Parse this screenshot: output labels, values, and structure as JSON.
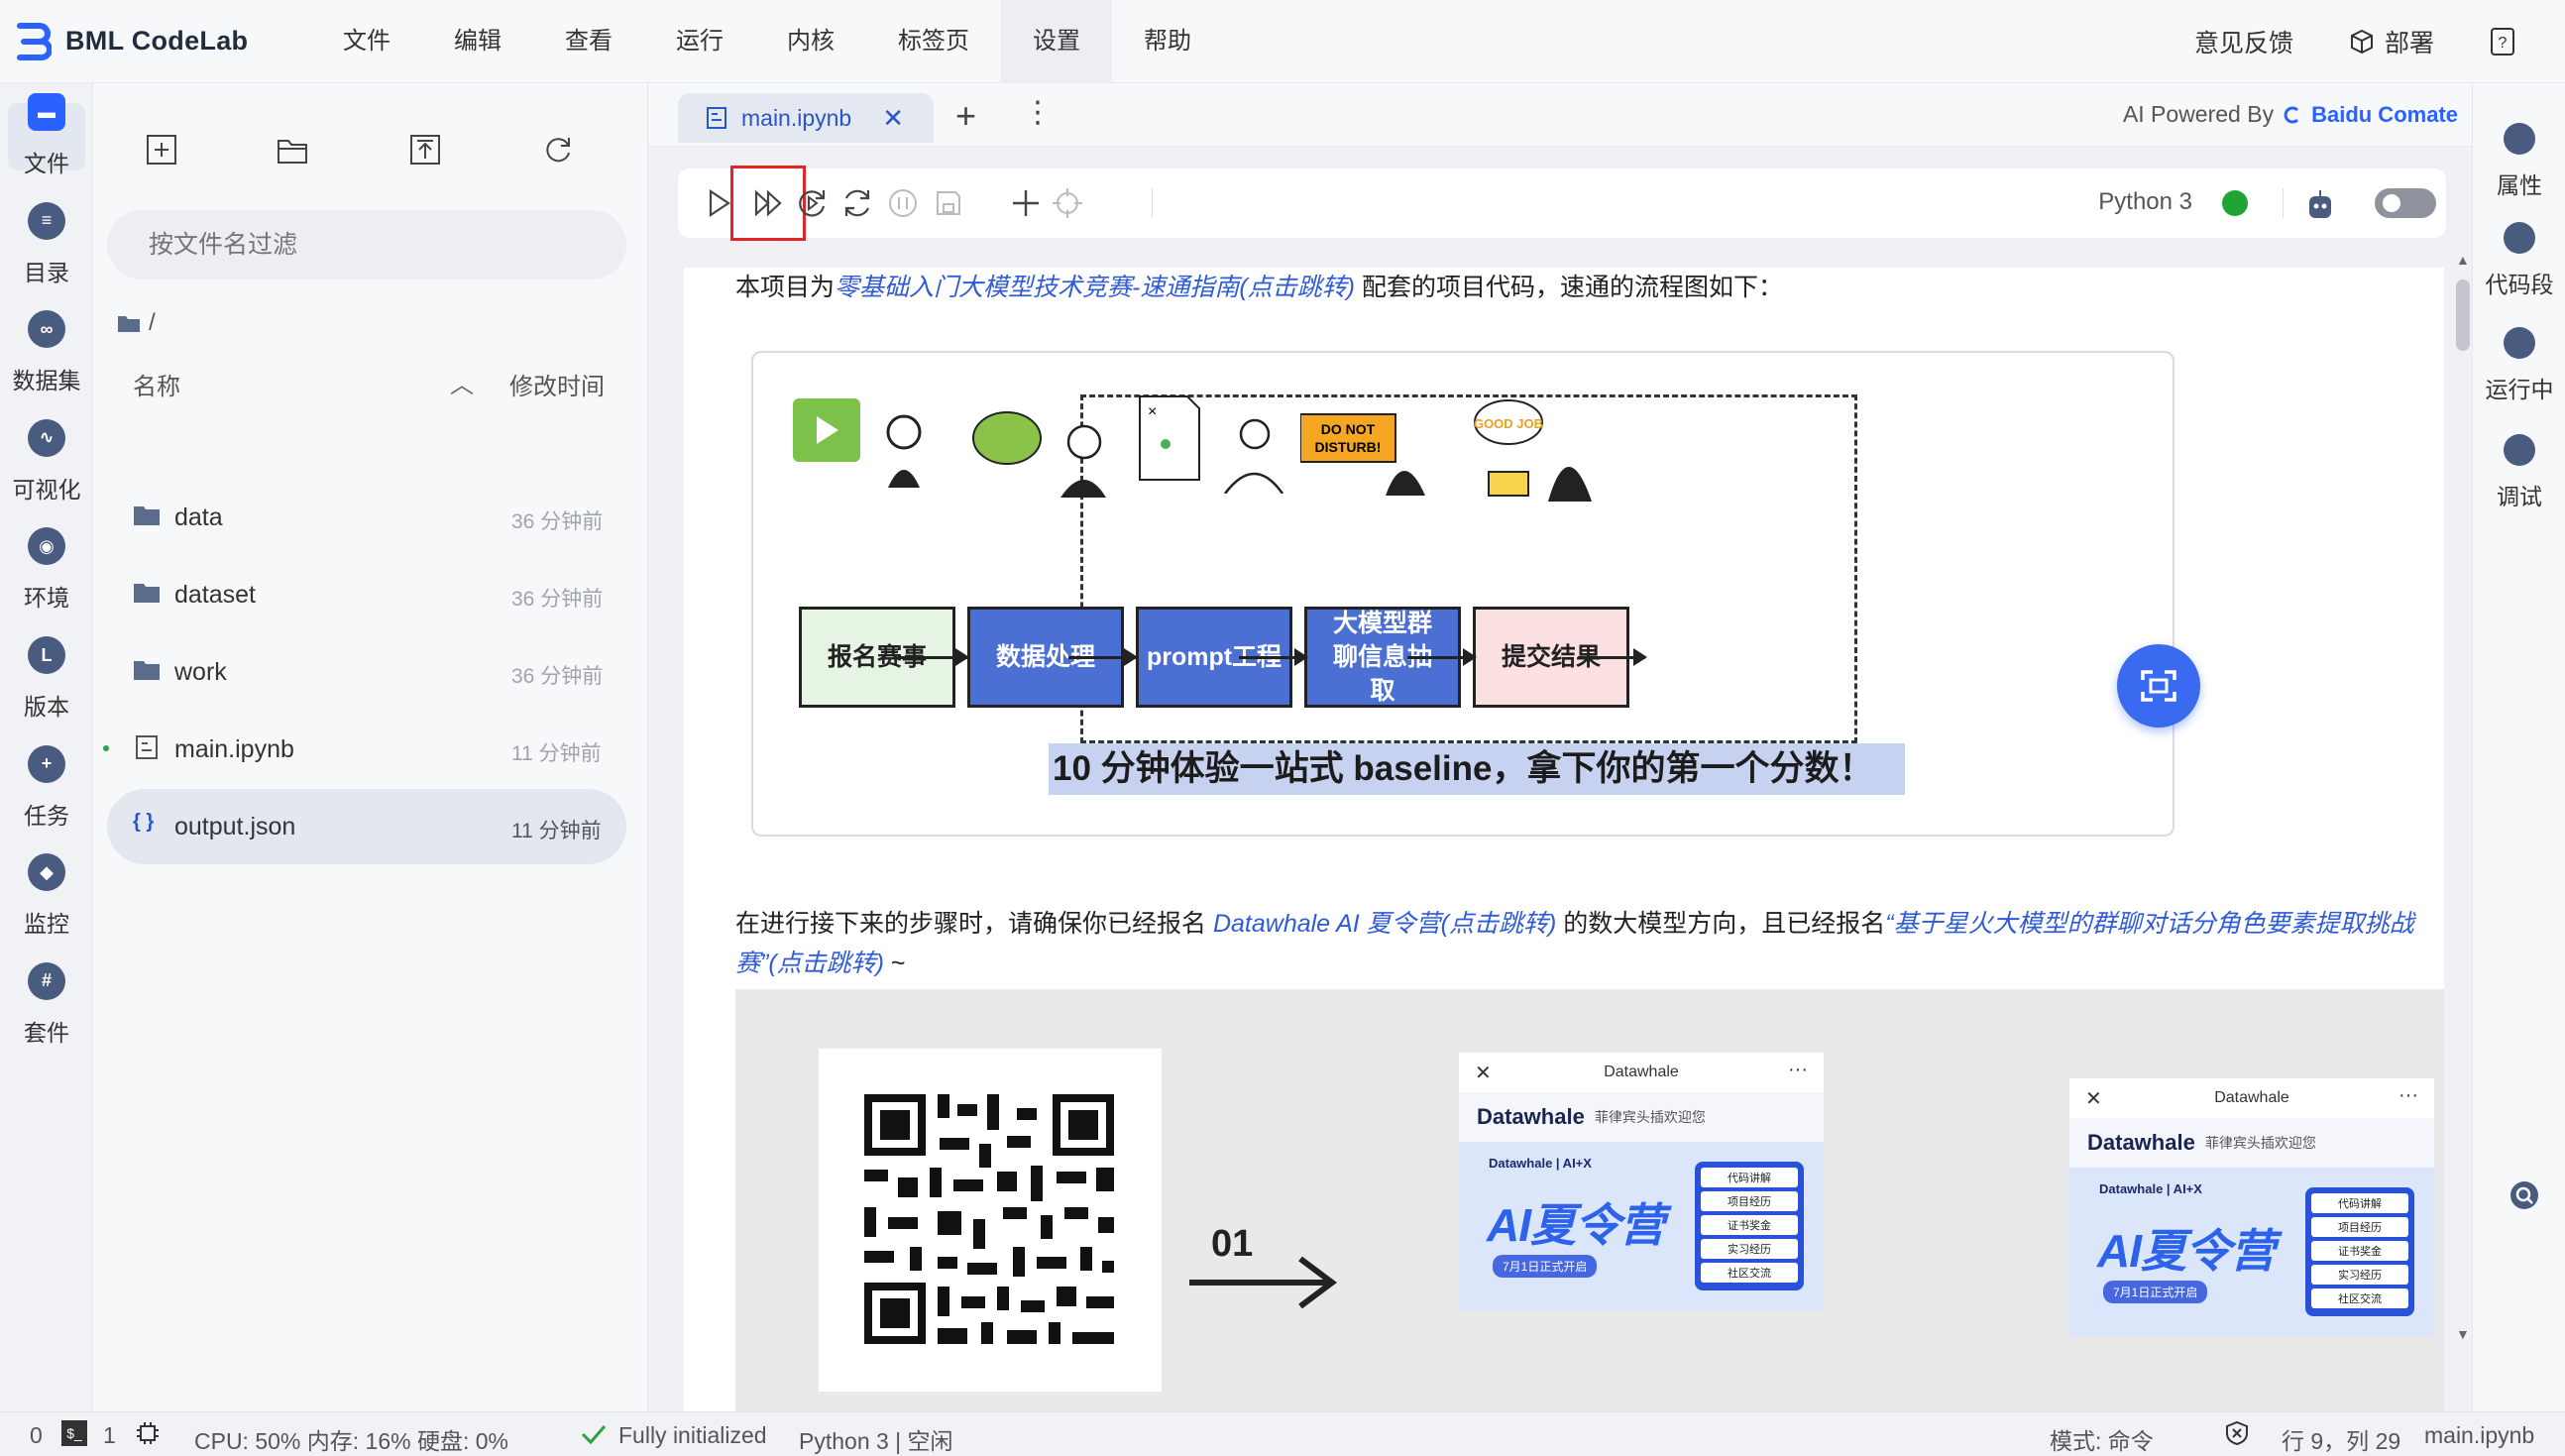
{
  "app": {
    "title": "BML CodeLab"
  },
  "menu": [
    "文件",
    "编辑",
    "查看",
    "运行",
    "内核",
    "标签页",
    "设置",
    "帮助"
  ],
  "menu_active_index": 6,
  "top_right": {
    "feedback": "意见反馈",
    "deploy": "部署"
  },
  "left_sidebar": [
    {
      "label": "文件",
      "icon": "folder-icon"
    },
    {
      "label": "目录",
      "icon": "list-icon"
    },
    {
      "label": "数据集",
      "icon": "dataset-icon"
    },
    {
      "label": "可视化",
      "icon": "chart-icon"
    },
    {
      "label": "环境",
      "icon": "environment-icon"
    },
    {
      "label": "版本",
      "icon": "version-icon"
    },
    {
      "label": "任务",
      "icon": "task-icon"
    },
    {
      "label": "监控",
      "icon": "monitor-icon"
    },
    {
      "label": "套件",
      "icon": "suite-icon"
    }
  ],
  "file_panel": {
    "search_placeholder": "按文件名过滤",
    "path": "/",
    "col_name": "名称",
    "col_time": "修改时间",
    "files": [
      {
        "name": "data",
        "time": "36 分钟前",
        "type": "folder"
      },
      {
        "name": "dataset",
        "time": "36 分钟前",
        "type": "folder"
      },
      {
        "name": "work",
        "time": "36 分钟前",
        "type": "folder"
      },
      {
        "name": "main.ipynb",
        "time": "11 分钟前",
        "type": "notebook"
      },
      {
        "name": "output.json",
        "time": "11 分钟前",
        "type": "json"
      }
    ]
  },
  "editor": {
    "tab_name": "main.ipynb",
    "ai_powered_label": "AI Powered By",
    "ai_brand": "Baidu Comate",
    "kernel_name": "Python 3",
    "kernel_status_color": "#20a535"
  },
  "notebook": {
    "para1_prefix": "本项目为",
    "para1_link": "零基础入门大模型技术竞赛-速通指南(点击跳转)",
    "para1_suffix": " 配套的项目代码，速通的流程图如下：",
    "flow_steps": [
      "报名赛事",
      "数据处理",
      "prompt工程",
      "大模型群聊信息抽取",
      "提交结果"
    ],
    "flow_caption": "10 分钟体验一站式 baseline，拿下你的第一个分数！",
    "para2_prefix": "在进行接下来的步骤时，请确保你已经报名 ",
    "para2_link1": "Datawhale AI 夏令营(点击跳转)",
    "para2_mid": " 的数大模型方向，且已经报名",
    "para2_link2": "“基于星火大模型的群聊对话分角色要素提取挑战赛”(点击跳转)",
    "para2_suffix": " ~",
    "step_number": "01",
    "phone_title": "Datawhale",
    "phone_brand": "Datawhale",
    "phone_sub": "菲律宾头插欢迎您",
    "phone_banner_tag": "Datawhale  |  AI+X",
    "phone_banner_title": "AI夏令营",
    "phone_banner_date": "7月1日正式开启",
    "phone_menu": [
      "代码讲解",
      "项目经历",
      "证书奖金",
      "实习经历",
      "社区交流"
    ]
  },
  "right_sidebar": [
    {
      "label": "属性",
      "icon": "properties-icon"
    },
    {
      "label": "代码段",
      "icon": "snippet-icon"
    },
    {
      "label": "运行中",
      "icon": "running-icon"
    },
    {
      "label": "调试",
      "icon": "debug-icon"
    }
  ],
  "status_bar": {
    "count1": "0",
    "count2": "1",
    "resources": "CPU:  50% 内存:  16% 硬盘:  0%",
    "init_status": "Fully initialized",
    "kernel_status": "Python 3 | 空闲",
    "mode": "模式:  命令",
    "cursor": "行 9，列 29",
    "filename": "main.ipynb"
  }
}
